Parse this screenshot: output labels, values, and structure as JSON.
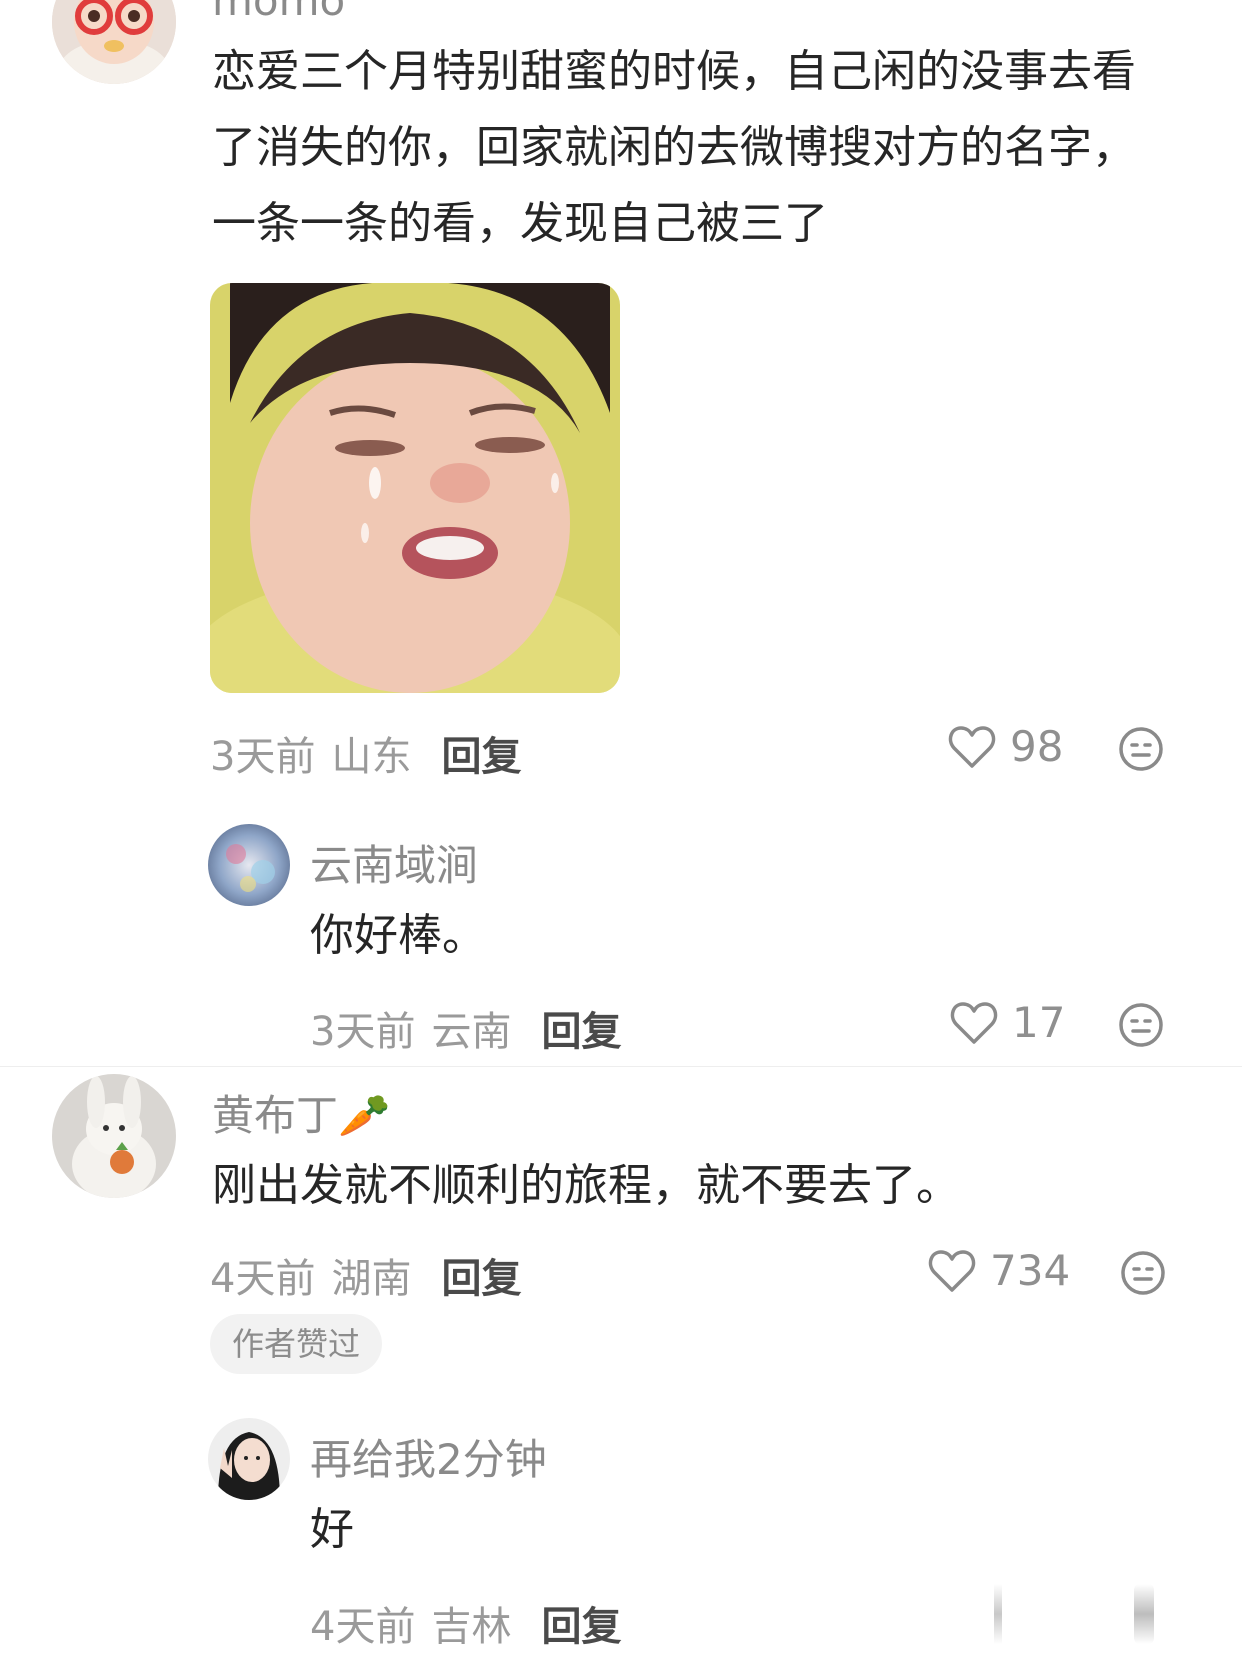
{
  "comments": [
    {
      "user": "momo",
      "text": "恋爱三个月特别甜蜜的时候，自己闲的没事去看了消失的你，回家就闲的去微博搜对方的名字，一条一条的看，发现自己被三了",
      "time": "3天前",
      "location": "山东",
      "reply_label": "回复",
      "likes": "98",
      "replies": [
        {
          "user": "云南域涧",
          "text": "你好棒。",
          "time": "3天前",
          "location": "云南",
          "reply_label": "回复",
          "likes": "17"
        }
      ]
    },
    {
      "user": "黄布丁🥕",
      "text": "刚出发就不顺利的旅程，就不要去了。",
      "time": "4天前",
      "location": "湖南",
      "reply_label": "回复",
      "likes": "734",
      "badge": "作者赞过",
      "replies": [
        {
          "user": "再给我2分钟",
          "text": "好",
          "time": "4天前",
          "location": "吉林",
          "reply_label": "回复"
        }
      ]
    }
  ],
  "icons": {
    "like": "heart-icon",
    "emoji": "emoji-face-icon"
  },
  "colors": {
    "name": "#8a8a8a",
    "text": "#262626",
    "meta": "#9a9a9a",
    "reply": "#4a4a4a"
  }
}
